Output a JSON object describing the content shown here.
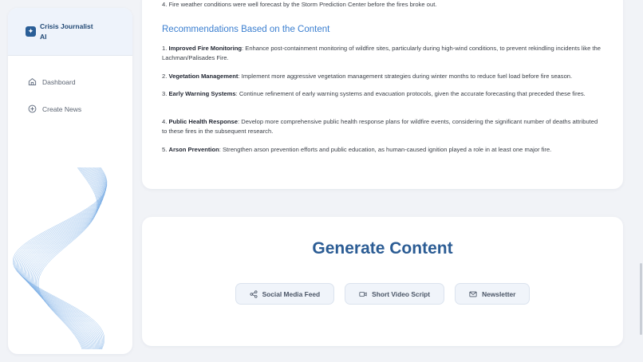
{
  "brand": {
    "title": "Crisis Journalist AI"
  },
  "sidebar": {
    "items": [
      {
        "label": "Dashboard",
        "icon": "home-icon"
      },
      {
        "label": "Create News",
        "icon": "plus-circle-icon"
      }
    ]
  },
  "report": {
    "top_line": "4. Fire weather conditions were well forecast by the Storm Prediction Center before the fires broke out.",
    "heading": "Recommendations Based on the Content",
    "recs": [
      {
        "num": "1.",
        "title": "Improved Fire Monitoring",
        "text": ": Enhance post-containment monitoring of wildfire sites, particularly during high-wind conditions, to prevent rekindling incidents like the Lachman/Palisades Fire."
      },
      {
        "num": "2.",
        "title": "Vegetation Management",
        "text": ": Implement more aggressive vegetation management strategies during winter months to reduce fuel load before fire season."
      },
      {
        "num": "3.",
        "title": "Early Warning Systems",
        "text": ": Continue refinement of early warning systems and evacuation protocols, given the accurate forecasting that preceded these fires."
      },
      {
        "num": "4.",
        "title": "Public Health Response",
        "text": ": Develop more comprehensive public health response plans for wildfire events, considering the significant number of deaths attributed to these fires in the subsequent research."
      },
      {
        "num": "5.",
        "title": "Arson Prevention",
        "text": ": Strengthen arson prevention efforts and public education, as human-caused ignition played a role in at least one major fire."
      }
    ]
  },
  "generate": {
    "title": "Generate Content",
    "buttons": [
      {
        "label": "Social Media Feed",
        "icon": "share-icon"
      },
      {
        "label": "Short Video Script",
        "icon": "video-icon"
      },
      {
        "label": "Newsletter",
        "icon": "mail-icon"
      }
    ]
  }
}
